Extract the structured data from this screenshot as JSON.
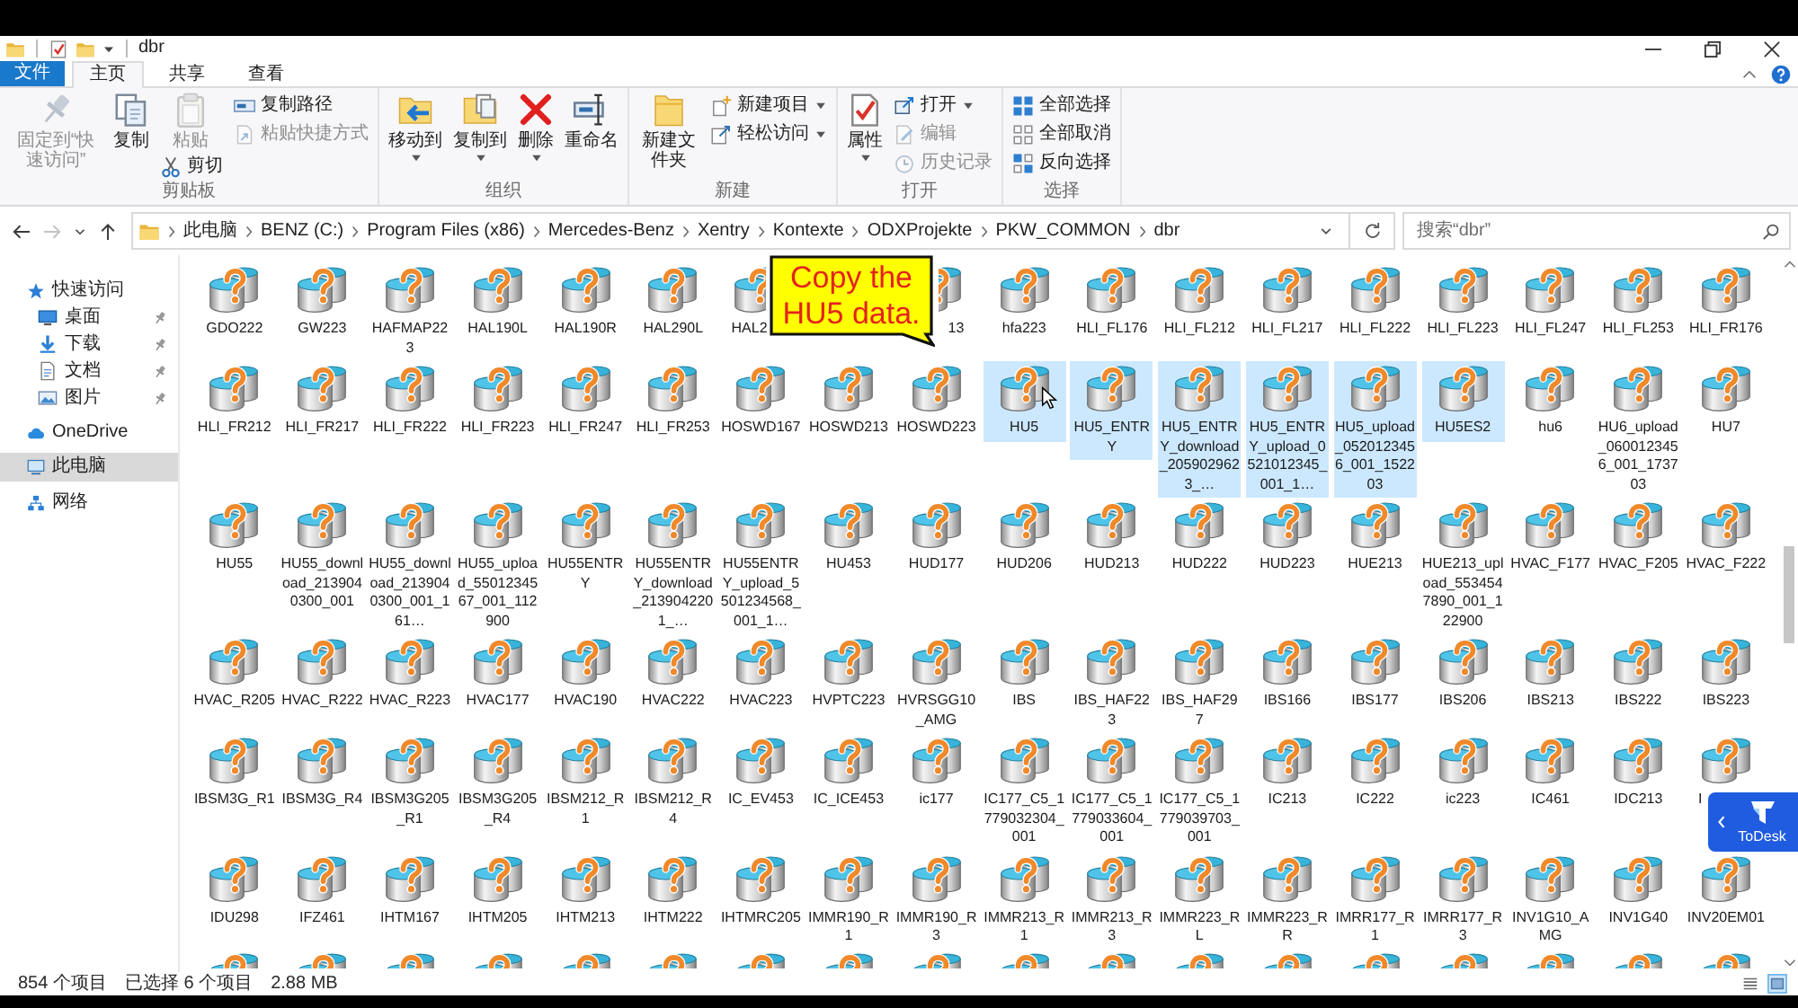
{
  "title_bar": {
    "title": "dbr"
  },
  "file_menu": {
    "label": "文件"
  },
  "tabs": [
    {
      "label": "主页",
      "selected": true
    },
    {
      "label": "共享",
      "selected": false
    },
    {
      "label": "查看",
      "selected": false
    }
  ],
  "ribbon": {
    "groups": [
      {
        "label": "剪贴板",
        "columns": [
          [
            {
              "label": "固定到“快速访问”",
              "kind": "pin",
              "large": true,
              "disabled": true,
              "dropdown": false
            }
          ],
          [
            {
              "label": "复制",
              "kind": "copy",
              "large": true,
              "disabled": false,
              "dropdown": false
            }
          ],
          [
            {
              "label": "粘贴",
              "kind": "paste",
              "large": true,
              "disabled": true,
              "dropdown": false
            },
            {
              "label": "剪切",
              "kind": "cut",
              "large": false,
              "disabled": false,
              "dropdown": false
            }
          ],
          [
            {
              "label": "复制路径",
              "kind": "copy_path",
              "large": false,
              "disabled": false,
              "dropdown": false
            },
            {
              "label": "粘贴快捷方式",
              "kind": "paste_shortcut",
              "large": false,
              "disabled": true,
              "dropdown": false
            }
          ]
        ]
      },
      {
        "label": "组织",
        "columns": [
          [
            {
              "label": "移动到",
              "kind": "move_to",
              "large": true,
              "disabled": false,
              "dropdown": true
            }
          ],
          [
            {
              "label": "复制到",
              "kind": "copy_to",
              "large": true,
              "disabled": false,
              "dropdown": true
            }
          ],
          [
            {
              "label": "删除",
              "kind": "delete",
              "large": true,
              "disabled": false,
              "dropdown": true
            }
          ],
          [
            {
              "label": "重命名",
              "kind": "rename",
              "large": true,
              "disabled": false,
              "dropdown": false
            }
          ]
        ]
      },
      {
        "label": "新建",
        "columns": [
          [
            {
              "label": "新建文件夹",
              "kind": "new_folder",
              "large": true,
              "disabled": false,
              "dropdown": false
            }
          ],
          [
            {
              "label": "新建项目",
              "kind": "new_item",
              "large": false,
              "disabled": false,
              "dropdown": true
            },
            {
              "label": "轻松访问",
              "kind": "easy_access",
              "large": false,
              "disabled": false,
              "dropdown": true
            }
          ]
        ]
      },
      {
        "label": "打开",
        "columns": [
          [
            {
              "label": "属性",
              "kind": "properties",
              "large": true,
              "disabled": false,
              "dropdown": true
            }
          ],
          [
            {
              "label": "打开",
              "kind": "open",
              "large": false,
              "disabled": false,
              "dropdown": true
            },
            {
              "label": "编辑",
              "kind": "edit",
              "large": false,
              "disabled": true,
              "dropdown": false
            },
            {
              "label": "历史记录",
              "kind": "history",
              "large": false,
              "disabled": true,
              "dropdown": false
            }
          ]
        ]
      },
      {
        "label": "选择",
        "columns": [
          [
            {
              "label": "全部选择",
              "kind": "select_all",
              "large": false,
              "disabled": false,
              "dropdown": false
            },
            {
              "label": "全部取消",
              "kind": "select_none",
              "large": false,
              "disabled": false,
              "dropdown": false
            },
            {
              "label": "反向选择",
              "kind": "invert_selection",
              "large": false,
              "disabled": false,
              "dropdown": false
            }
          ]
        ]
      }
    ]
  },
  "address_bar": {
    "nav_buttons": [
      {
        "kind": "back",
        "disabled": false
      },
      {
        "kind": "forward",
        "disabled": true
      },
      {
        "kind": "recent",
        "disabled": false
      },
      {
        "kind": "up",
        "disabled": false
      }
    ],
    "crumbs": [
      "此电脑",
      "BENZ (C:)",
      "Program Files (x86)",
      "Mercedes-Benz",
      "Xentry",
      "Kontexte",
      "ODXProjekte",
      "PKW_COMMON",
      "dbr"
    ]
  },
  "search": {
    "placeholder": "搜索“dbr”"
  },
  "navigation": {
    "items": [
      {
        "label": "快速访问",
        "kind": "star",
        "selected": false,
        "children": [
          {
            "label": "桌面",
            "kind": "desktop",
            "selected": false,
            "pinned": true
          },
          {
            "label": "下载",
            "kind": "download",
            "selected": false,
            "pinned": true
          },
          {
            "label": "文档",
            "kind": "documents",
            "selected": false,
            "pinned": true
          },
          {
            "label": "图片",
            "kind": "pictures",
            "selected": false,
            "pinned": true
          }
        ]
      },
      {
        "label": "OneDrive",
        "kind": "cloud",
        "selected": false
      },
      {
        "label": "此电脑",
        "kind": "computer",
        "selected": true
      },
      {
        "label": "网络",
        "kind": "network",
        "selected": false
      }
    ]
  },
  "files": [
    {
      "name": "GDO222",
      "kind": "file",
      "selected": false
    },
    {
      "name": "GW223",
      "kind": "file",
      "selected": false
    },
    {
      "name": "HAFMAP223",
      "kind": "file",
      "selected": false
    },
    {
      "name": "HAL190L",
      "kind": "file",
      "selected": false
    },
    {
      "name": "HAL190R",
      "kind": "file",
      "selected": false
    },
    {
      "name": "HAL290L",
      "kind": "file",
      "selected": false
    },
    {
      "name": "HAL2",
      "kind": "cut_right",
      "selected": false
    },
    {
      "kind": "covered"
    },
    {
      "name": "13",
      "kind": "cut_left",
      "selected": false
    },
    {
      "name": "hfa223",
      "kind": "file",
      "selected": false
    },
    {
      "name": "HLI_FL176",
      "kind": "file",
      "selected": false
    },
    {
      "name": "HLI_FL212",
      "kind": "file",
      "selected": false
    },
    {
      "name": "HLI_FL217",
      "kind": "file",
      "selected": false
    },
    {
      "name": "HLI_FL222",
      "kind": "file",
      "selected": false
    },
    {
      "name": "HLI_FL223",
      "kind": "file",
      "selected": false
    },
    {
      "name": "HLI_FL247",
      "kind": "file",
      "selected": false
    },
    {
      "name": "HLI_FL253",
      "kind": "file",
      "selected": false
    },
    {
      "name": "HLI_FR176",
      "kind": "file",
      "selected": false
    },
    {
      "name": "HLI_FR212",
      "kind": "file",
      "selected": false
    },
    {
      "name": "HLI_FR217",
      "kind": "file",
      "selected": false
    },
    {
      "name": "HLI_FR222",
      "kind": "file",
      "selected": false
    },
    {
      "name": "HLI_FR223",
      "kind": "file",
      "selected": false
    },
    {
      "name": "HLI_FR247",
      "kind": "file",
      "selected": false
    },
    {
      "name": "HLI_FR253",
      "kind": "file",
      "selected": false
    },
    {
      "name": "HOSWD167",
      "kind": "file",
      "selected": false
    },
    {
      "name": "HOSWD213",
      "kind": "file",
      "selected": false
    },
    {
      "name": "HOSWD223",
      "kind": "file",
      "selected": false
    },
    {
      "name": "HU5",
      "kind": "file",
      "selected": true
    },
    {
      "name": "HU5_ENTRY",
      "kind": "file",
      "selected": true
    },
    {
      "name": "HU5_ENTRY_download_2059029623_…",
      "kind": "file",
      "selected": true
    },
    {
      "name": "HU5_ENTRY_upload_0521012345_001_1…",
      "kind": "file",
      "selected": true
    },
    {
      "name": "HU5_upload_0520123456_001_152203",
      "kind": "file",
      "selected": true
    },
    {
      "name": "HU5ES2",
      "kind": "file",
      "selected": true
    },
    {
      "name": "hu6",
      "kind": "file",
      "selected": false
    },
    {
      "name": "HU6_upload_0600123456_001_173703",
      "kind": "file",
      "selected": false
    },
    {
      "name": "HU7",
      "kind": "file",
      "selected": false
    },
    {
      "name": "HU55",
      "kind": "file",
      "selected": false
    },
    {
      "name": "HU55_download_2139040300_001",
      "kind": "file",
      "selected": false
    },
    {
      "name": "HU55_download_2139040300_001_161…",
      "kind": "file",
      "selected": false
    },
    {
      "name": "HU55_upload_5501234567_001_112900",
      "kind": "file",
      "selected": false
    },
    {
      "name": "HU55ENTRY",
      "kind": "file",
      "selected": false
    },
    {
      "name": "HU55ENTRY_download_2139042201_…",
      "kind": "file",
      "selected": false
    },
    {
      "name": "HU55ENTRY_upload_5501234568_001_1…",
      "kind": "file",
      "selected": false
    },
    {
      "name": "HU453",
      "kind": "file",
      "selected": false
    },
    {
      "name": "HUD177",
      "kind": "file",
      "selected": false
    },
    {
      "name": "HUD206",
      "kind": "file",
      "selected": false
    },
    {
      "name": "HUD213",
      "kind": "file",
      "selected": false
    },
    {
      "name": "HUD222",
      "kind": "file",
      "selected": false
    },
    {
      "name": "HUD223",
      "kind": "file",
      "selected": false
    },
    {
      "name": "HUE213",
      "kind": "file",
      "selected": false
    },
    {
      "name": "HUE213_upload_5534547890_001_122900",
      "kind": "file",
      "selected": false
    },
    {
      "name": "HVAC_F177",
      "kind": "file",
      "selected": false
    },
    {
      "name": "HVAC_F205",
      "kind": "file",
      "selected": false
    },
    {
      "name": "HVAC_F222",
      "kind": "file",
      "selected": false
    },
    {
      "name": "HVAC_R205",
      "kind": "file",
      "selected": false
    },
    {
      "name": "HVAC_R222",
      "kind": "file",
      "selected": false
    },
    {
      "name": "HVAC_R223",
      "kind": "file",
      "selected": false
    },
    {
      "name": "HVAC177",
      "kind": "file",
      "selected": false
    },
    {
      "name": "HVAC190",
      "kind": "file",
      "selected": false
    },
    {
      "name": "HVAC222",
      "kind": "file",
      "selected": false
    },
    {
      "name": "HVAC223",
      "kind": "file",
      "selected": false
    },
    {
      "name": "HVPTC223",
      "kind": "file",
      "selected": false
    },
    {
      "name": "HVRSGG10_AMG",
      "kind": "file",
      "selected": false
    },
    {
      "name": "IBS",
      "kind": "file",
      "selected": false
    },
    {
      "name": "IBS_HAF223",
      "kind": "file",
      "selected": false
    },
    {
      "name": "IBS_HAF297",
      "kind": "file",
      "selected": false
    },
    {
      "name": "IBS166",
      "kind": "file",
      "selected": false
    },
    {
      "name": "IBS177",
      "kind": "file",
      "selected": false
    },
    {
      "name": "IBS206",
      "kind": "file",
      "selected": false
    },
    {
      "name": "IBS213",
      "kind": "file",
      "selected": false
    },
    {
      "name": "IBS222",
      "kind": "file",
      "selected": false
    },
    {
      "name": "IBS223",
      "kind": "file",
      "selected": false
    },
    {
      "name": "IBSM3G_R1",
      "kind": "file",
      "selected": false
    },
    {
      "name": "IBSM3G_R4",
      "kind": "file",
      "selected": false
    },
    {
      "name": "IBSM3G205_R1",
      "kind": "file",
      "selected": false
    },
    {
      "name": "IBSM3G205_R4",
      "kind": "file",
      "selected": false
    },
    {
      "name": "IBSM212_R1",
      "kind": "file",
      "selected": false
    },
    {
      "name": "IBSM212_R4",
      "kind": "file",
      "selected": false
    },
    {
      "name": "IC_EV453",
      "kind": "file",
      "selected": false
    },
    {
      "name": "IC_ICE453",
      "kind": "file",
      "selected": false
    },
    {
      "name": "ic177",
      "kind": "file",
      "selected": false
    },
    {
      "name": "IC177_C5_1779032304_001",
      "kind": "file",
      "selected": false
    },
    {
      "name": "IC177_C5_1779033604_001",
      "kind": "file",
      "selected": false
    },
    {
      "name": "IC177_C5_1779039703_001",
      "kind": "file",
      "selected": false
    },
    {
      "name": "IC213",
      "kind": "file",
      "selected": false
    },
    {
      "name": "IC222",
      "kind": "file",
      "selected": false
    },
    {
      "name": "ic223",
      "kind": "file",
      "selected": false
    },
    {
      "name": "IC461",
      "kind": "file",
      "selected": false
    },
    {
      "name": "IDC213",
      "kind": "file",
      "selected": false
    },
    {
      "name": "I",
      "kind": "cut_label",
      "selected": false
    },
    {
      "name": "IDU298",
      "kind": "file",
      "selected": false
    },
    {
      "name": "IFZ461",
      "kind": "file",
      "selected": false
    },
    {
      "name": "IHTM167",
      "kind": "file",
      "selected": false
    },
    {
      "name": "IHTM205",
      "kind": "file",
      "selected": false
    },
    {
      "name": "IHTM213",
      "kind": "file",
      "selected": false
    },
    {
      "name": "IHTM222",
      "kind": "file",
      "selected": false
    },
    {
      "name": "IHTMRC205",
      "kind": "file",
      "selected": false
    },
    {
      "name": "IMMR190_R1",
      "kind": "file",
      "selected": false
    },
    {
      "name": "IMMR190_R3",
      "kind": "file",
      "selected": false
    },
    {
      "name": "IMMR213_R1",
      "kind": "file",
      "selected": false
    },
    {
      "name": "IMMR213_R3",
      "kind": "file",
      "selected": false
    },
    {
      "name": "IMMR223_RL",
      "kind": "file",
      "selected": false
    },
    {
      "name": "IMMR223_RR",
      "kind": "file",
      "selected": false
    },
    {
      "name": "IMRR177_R1",
      "kind": "file",
      "selected": false
    },
    {
      "name": "IMRR177_R3",
      "kind": "file",
      "selected": false
    },
    {
      "name": "INV1G10_AMG",
      "kind": "file",
      "selected": false
    },
    {
      "name": "INV1G40",
      "kind": "file",
      "selected": false
    },
    {
      "name": "INV20EM01",
      "kind": "file",
      "selected": false
    },
    {
      "kind": "peek",
      "selected": false
    },
    {
      "kind": "peek",
      "selected": false
    },
    {
      "kind": "peek",
      "selected": false
    },
    {
      "kind": "peek",
      "selected": false
    },
    {
      "kind": "peek",
      "selected": false
    },
    {
      "kind": "peek",
      "selected": false
    },
    {
      "kind": "peek",
      "selected": false
    },
    {
      "kind": "peek",
      "selected": false
    },
    {
      "kind": "peek",
      "selected": false
    },
    {
      "kind": "peek",
      "selected": false
    },
    {
      "kind": "peek",
      "selected": false
    },
    {
      "kind": "peek",
      "selected": false
    },
    {
      "kind": "peek",
      "selected": false
    },
    {
      "kind": "peek",
      "selected": false
    },
    {
      "kind": "peek",
      "selected": false
    },
    {
      "kind": "peek",
      "selected": false
    },
    {
      "kind": "peek",
      "selected": false
    },
    {
      "kind": "peek",
      "selected": false
    }
  ],
  "status_bar": {
    "items": [
      "854 个项目",
      "已选择 6 个项目",
      "2.88 MB"
    ]
  },
  "views": [
    {
      "kind": "details",
      "selected": false
    },
    {
      "kind": "large_icons",
      "selected": true
    }
  ],
  "callout": {
    "text": "Copy the HU5 data."
  },
  "todesk": {
    "label": "ToDesk"
  }
}
